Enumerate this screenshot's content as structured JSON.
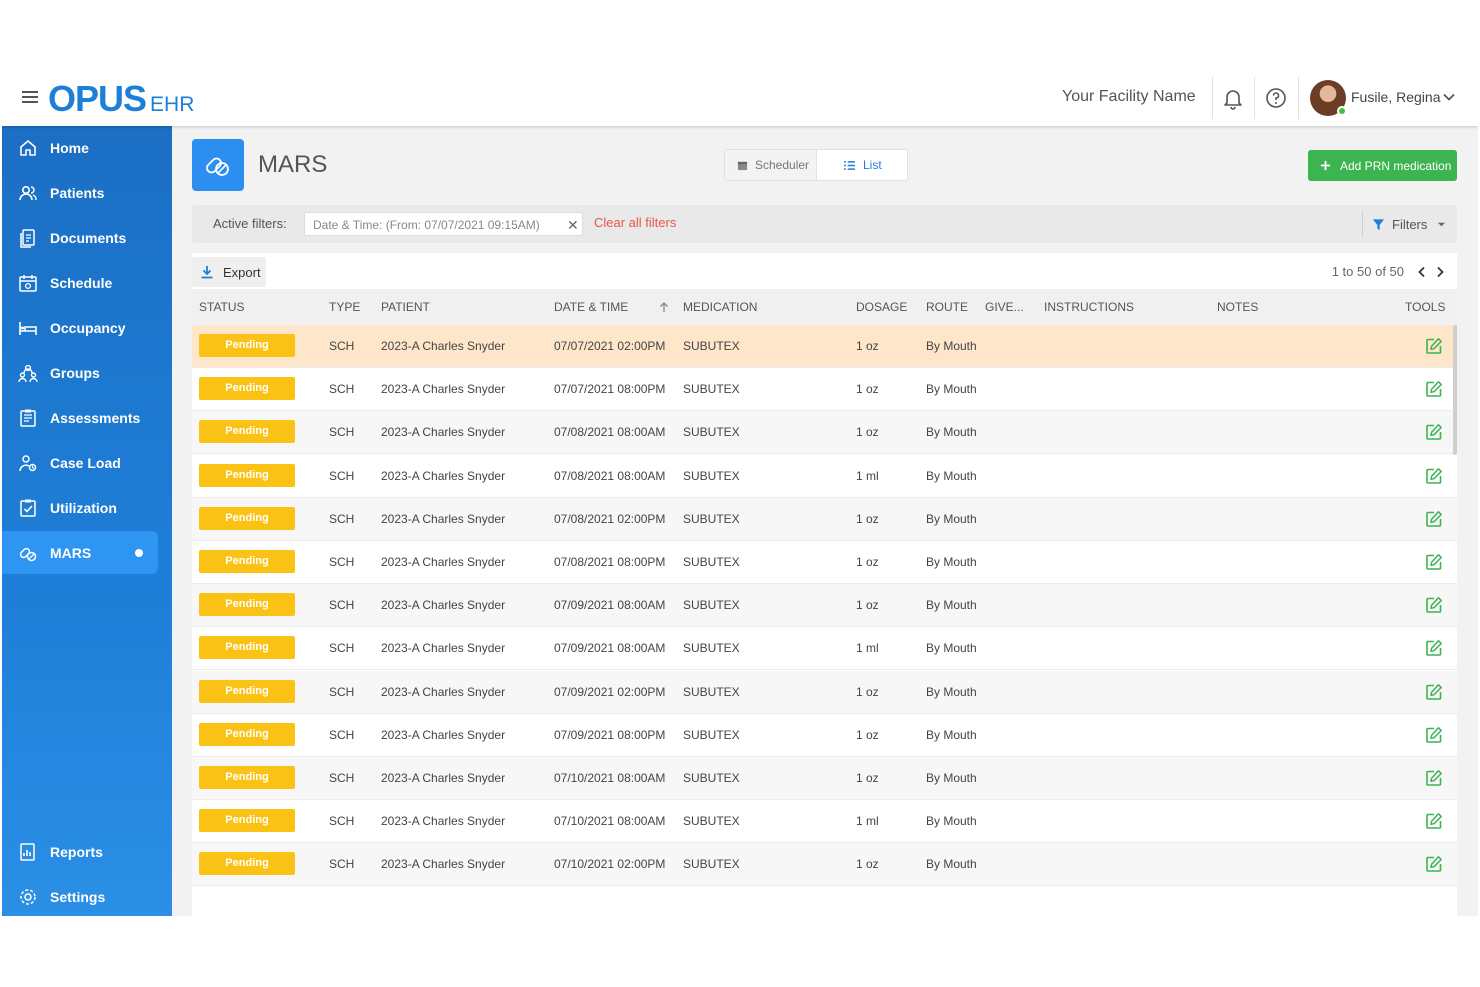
{
  "app": {
    "logo_main": "OPUS",
    "logo_sub": "EHR"
  },
  "header": {
    "facility": "Your Facility Name",
    "user_name": "Fusile, Regina",
    "icons": [
      "menu-icon",
      "bell-icon",
      "help-icon",
      "chevron-down-icon"
    ]
  },
  "sidebar": {
    "items": [
      {
        "label": "Home",
        "icon": "home-icon"
      },
      {
        "label": "Patients",
        "icon": "patients-icon"
      },
      {
        "label": "Documents",
        "icon": "documents-icon"
      },
      {
        "label": "Schedule",
        "icon": "schedule-icon"
      },
      {
        "label": "Occupancy",
        "icon": "bed-icon"
      },
      {
        "label": "Groups",
        "icon": "groups-icon"
      },
      {
        "label": "Assessments",
        "icon": "assessments-icon"
      },
      {
        "label": "Case Load",
        "icon": "caseload-icon"
      },
      {
        "label": "Utilization",
        "icon": "utilization-icon"
      },
      {
        "label": "MARS",
        "icon": "pills-icon",
        "active": true
      }
    ],
    "bottom_items": [
      {
        "label": "Reports",
        "icon": "reports-icon"
      },
      {
        "label": "Settings",
        "icon": "settings-icon"
      }
    ]
  },
  "page": {
    "title": "MARS",
    "view_scheduler": "Scheduler",
    "view_list": "List",
    "add_button": "Add PRN medication"
  },
  "filters": {
    "label": "Active filters:",
    "chip": "Date & Time: (From: 07/07/2021 09:15AM)",
    "clear": "Clear all filters",
    "button": "Filters"
  },
  "table": {
    "export_label": "Export",
    "pager": "1 to 50 of 50",
    "columns": [
      "STATUS",
      "TYPE",
      "PATIENT",
      "DATE & TIME",
      "MEDICATION",
      "DOSAGE",
      "ROUTE",
      "GIVE...",
      "INSTRUCTIONS",
      "NOTES",
      "TOOLS"
    ],
    "rows": [
      {
        "status": "Pending",
        "type": "SCH",
        "patient": "2023-A Charles Snyder",
        "datetime": "07/07/2021 02:00PM",
        "medication": "SUBUTEX",
        "dosage": "1 oz",
        "route": "By Mouth"
      },
      {
        "status": "Pending",
        "type": "SCH",
        "patient": "2023-A Charles Snyder",
        "datetime": "07/07/2021 08:00PM",
        "medication": "SUBUTEX",
        "dosage": "1 oz",
        "route": "By Mouth"
      },
      {
        "status": "Pending",
        "type": "SCH",
        "patient": "2023-A Charles Snyder",
        "datetime": "07/08/2021 08:00AM",
        "medication": "SUBUTEX",
        "dosage": "1 oz",
        "route": "By Mouth"
      },
      {
        "status": "Pending",
        "type": "SCH",
        "patient": "2023-A Charles Snyder",
        "datetime": "07/08/2021 08:00AM",
        "medication": "SUBUTEX",
        "dosage": "1 ml",
        "route": "By Mouth"
      },
      {
        "status": "Pending",
        "type": "SCH",
        "patient": "2023-A Charles Snyder",
        "datetime": "07/08/2021 02:00PM",
        "medication": "SUBUTEX",
        "dosage": "1 oz",
        "route": "By Mouth"
      },
      {
        "status": "Pending",
        "type": "SCH",
        "patient": "2023-A Charles Snyder",
        "datetime": "07/08/2021 08:00PM",
        "medication": "SUBUTEX",
        "dosage": "1 oz",
        "route": "By Mouth"
      },
      {
        "status": "Pending",
        "type": "SCH",
        "patient": "2023-A Charles Snyder",
        "datetime": "07/09/2021 08:00AM",
        "medication": "SUBUTEX",
        "dosage": "1 oz",
        "route": "By Mouth"
      },
      {
        "status": "Pending",
        "type": "SCH",
        "patient": "2023-A Charles Snyder",
        "datetime": "07/09/2021 08:00AM",
        "medication": "SUBUTEX",
        "dosage": "1 ml",
        "route": "By Mouth"
      },
      {
        "status": "Pending",
        "type": "SCH",
        "patient": "2023-A Charles Snyder",
        "datetime": "07/09/2021 02:00PM",
        "medication": "SUBUTEX",
        "dosage": "1 oz",
        "route": "By Mouth"
      },
      {
        "status": "Pending",
        "type": "SCH",
        "patient": "2023-A Charles Snyder",
        "datetime": "07/09/2021 08:00PM",
        "medication": "SUBUTEX",
        "dosage": "1 oz",
        "route": "By Mouth"
      },
      {
        "status": "Pending",
        "type": "SCH",
        "patient": "2023-A Charles Snyder",
        "datetime": "07/10/2021 08:00AM",
        "medication": "SUBUTEX",
        "dosage": "1 oz",
        "route": "By Mouth"
      },
      {
        "status": "Pending",
        "type": "SCH",
        "patient": "2023-A Charles Snyder",
        "datetime": "07/10/2021 08:00AM",
        "medication": "SUBUTEX",
        "dosage": "1 ml",
        "route": "By Mouth"
      },
      {
        "status": "Pending",
        "type": "SCH",
        "patient": "2023-A Charles Snyder",
        "datetime": "07/10/2021 02:00PM",
        "medication": "SUBUTEX",
        "dosage": "1 oz",
        "route": "By Mouth"
      }
    ]
  },
  "colors": {
    "brand": "#1e7fd8",
    "sidebar": "#1f7fd8",
    "pending": "#fbc216",
    "add_button": "#3cb450",
    "clear_link": "#e8574a",
    "highlight_row": "#fde6c9",
    "edit_icon": "#3cb450"
  }
}
